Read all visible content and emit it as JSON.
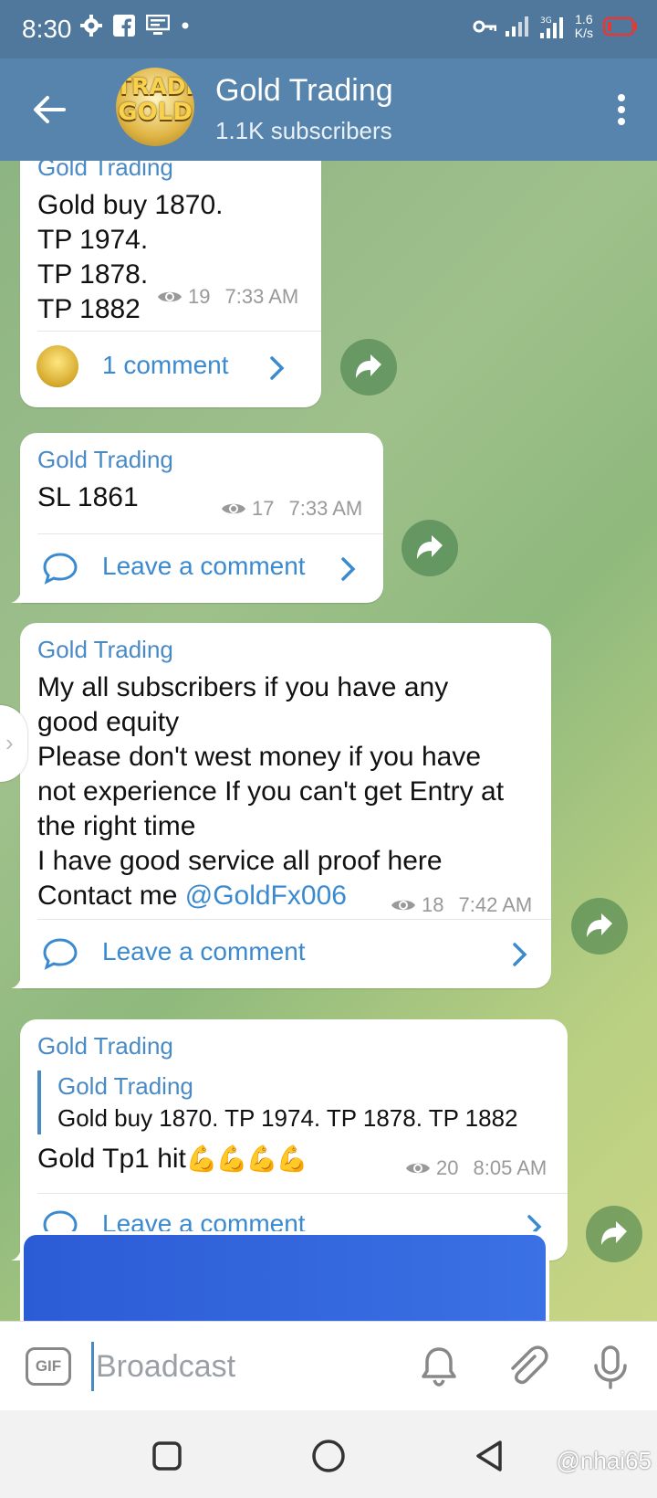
{
  "status": {
    "time": "8:30",
    "speed_value": "1.6",
    "speed_unit": "K/s",
    "network": "3G"
  },
  "header": {
    "title": "Gold Trading",
    "subtitle": "1.1K subscribers",
    "avatar_text_top": "TRADI",
    "avatar_text_bottom": "GOLD"
  },
  "messages": [
    {
      "sender": "Gold Trading",
      "text": "Gold buy 1870.\nTP 1974.\nTP 1878.\nTP 1882",
      "views": "19",
      "time": "7:33 AM",
      "comment_label": "1 comment"
    },
    {
      "sender": "Gold Trading",
      "text": "SL 1861",
      "views": "17",
      "time": "7:33 AM",
      "comment_label": "Leave a comment"
    },
    {
      "sender": "Gold Trading",
      "text": "My all subscribers if you have any\ngood equity\nPlease don't west money if you have\nnot experience If you can't get Entry at\nthe right time\nI have good service all proof here",
      "text_contact": "Contact me ",
      "mention": "@GoldFx006",
      "views": "18",
      "time": "7:42 AM",
      "comment_label": "Leave a comment"
    },
    {
      "sender": "Gold Trading",
      "quote_sender": "Gold Trading",
      "quote_text": "Gold buy 1870. TP 1974. TP 1878. TP 1882",
      "text": "Gold Tp1 hit",
      "emoji": "💪💪💪💪",
      "views": "20",
      "time": "8:05 AM",
      "comment_label": "Leave a comment"
    }
  ],
  "input": {
    "gif_label": "GIF",
    "placeholder": "Broadcast"
  },
  "watermark": "@nhai65",
  "colors": {
    "header": "#5784ad",
    "statusbar": "#4f789c",
    "accent": "#3b8ad0",
    "sender": "#4a8ac4"
  }
}
